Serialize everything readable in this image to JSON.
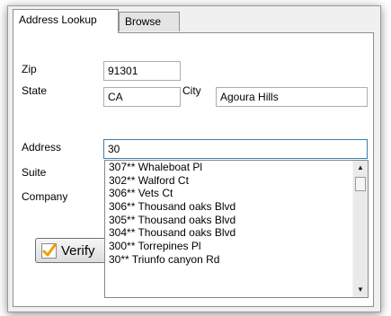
{
  "tabs": [
    {
      "label": "Address Lookup",
      "active": true
    },
    {
      "label": "Browse",
      "active": false
    }
  ],
  "form": {
    "zip_label": "Zip",
    "zip_value": "91301",
    "state_label": "State",
    "state_value": "CA",
    "city_label": "City",
    "city_value": "Agoura Hills",
    "address_label": "Address",
    "address_value": "30",
    "suite_label": "Suite",
    "company_label": "Company"
  },
  "suggestions": [
    "307** Whaleboat Pl",
    "302** Walford Ct",
    "306** Vets Ct",
    "306** Thousand oaks Blvd",
    "305** Thousand oaks Blvd",
    "304** Thousand oaks Blvd",
    "300** Torrepines Pl",
    "30** Triunfo canyon Rd"
  ],
  "buttons": {
    "verify_label": "Verify"
  },
  "icons": {
    "verify": "checkmark-icon",
    "scroll_up": "scroll-up-arrow-icon",
    "scroll_down": "scroll-down-arrow-icon"
  },
  "colors": {
    "verify_check": "#f0a000",
    "focus_border": "#3c7fb1"
  }
}
